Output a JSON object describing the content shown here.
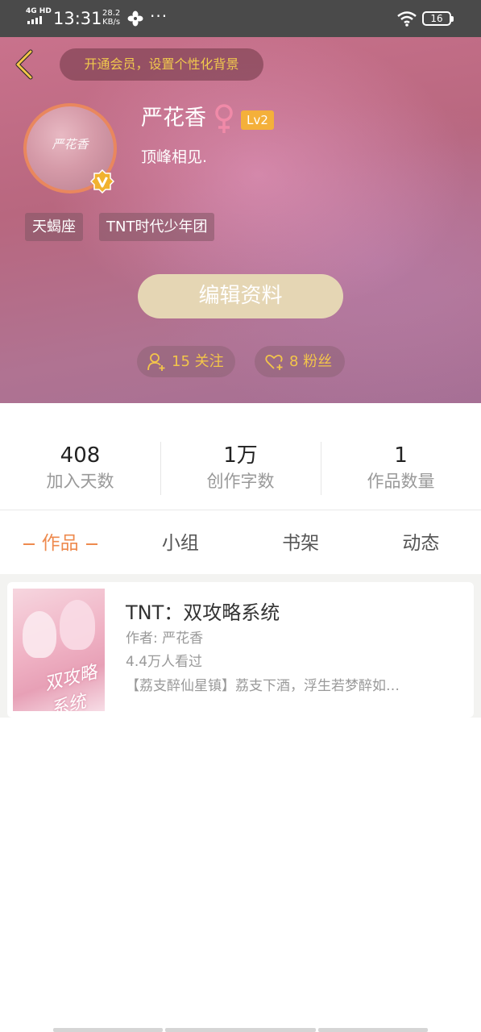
{
  "status_bar": {
    "network": "4G HD",
    "time": "13:31",
    "speed_value": "28.2",
    "speed_unit": "KB/s",
    "more": "···",
    "battery": "16"
  },
  "header": {
    "vip_banner": "开通会员，设置个性化背景",
    "avatar_text": "严花香",
    "name": "严花香",
    "level": "Lv2",
    "bio": "顶峰相见.",
    "tags": [
      "天蝎座",
      "TNT时代少年团"
    ],
    "edit_button": "编辑资料",
    "follow_label": "15 关注",
    "fans_label": "8 粉丝",
    "accent_color": "#f3c54a"
  },
  "stats": [
    {
      "value": "408",
      "label": "加入天数"
    },
    {
      "value": "1万",
      "label": "创作字数"
    },
    {
      "value": "1",
      "label": "作品数量"
    }
  ],
  "tabs": [
    {
      "label": "作品",
      "active": true
    },
    {
      "label": "小组",
      "active": false
    },
    {
      "label": "书架",
      "active": false
    },
    {
      "label": "动态",
      "active": false
    }
  ],
  "works": [
    {
      "title": "TNT：双攻略系统",
      "author": "作者: 严花香",
      "views": "4.4万人看过",
      "description": "【荔支醉仙星镇】荔支下酒，浮生若梦醉如…",
      "cover_art_text": "双攻略系统"
    }
  ],
  "colors": {
    "active_tab": "#ee8a4e",
    "edit_button_bg": "#e5d6b4",
    "level_badge": "#f4b03a"
  }
}
